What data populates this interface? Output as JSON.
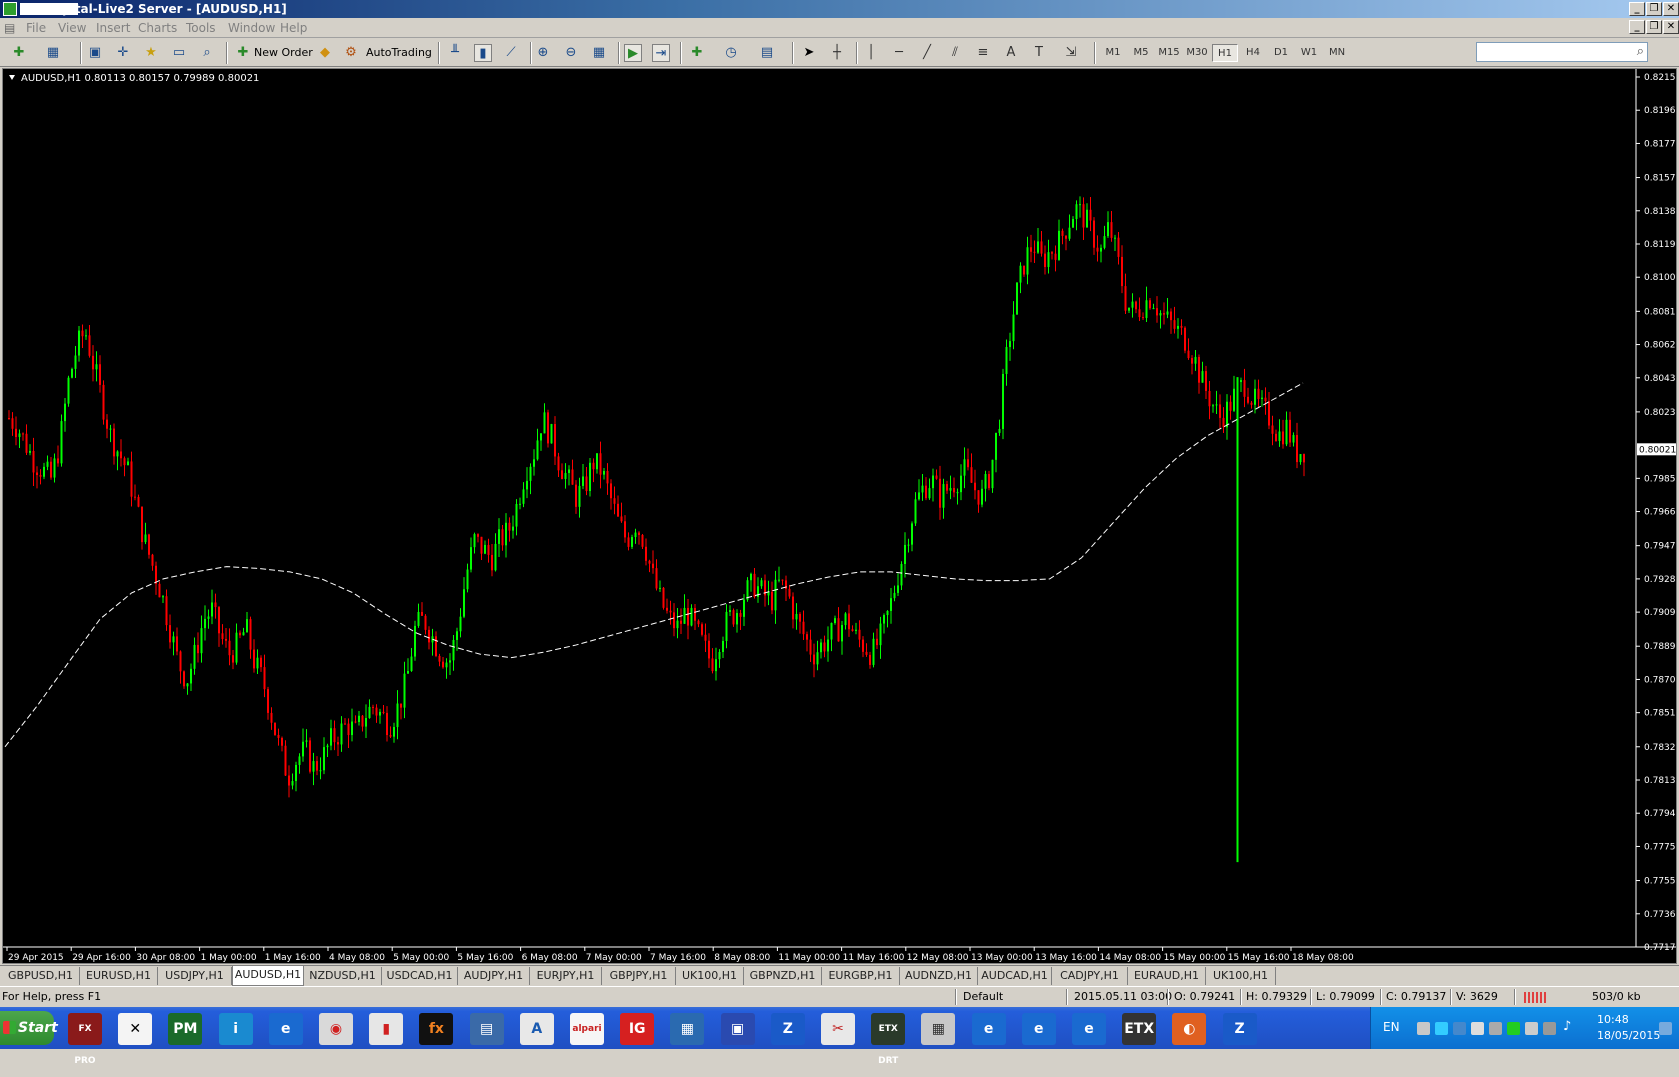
{
  "window": {
    "title": "ETXCapital-Live2 Server - [AUDUSD,H1]",
    "controls": [
      "_",
      "❐",
      "✕"
    ],
    "mdi_controls": [
      "_",
      "❐",
      "✕"
    ]
  },
  "menu": [
    "File",
    "View",
    "Insert",
    "Charts",
    "Tools",
    "Window",
    "Help"
  ],
  "toolbar": {
    "new_order": "New Order",
    "autotrading": "AutoTrading",
    "timeframes": [
      "M1",
      "M5",
      "M15",
      "M30",
      "H1",
      "H4",
      "D1",
      "W1",
      "MN"
    ],
    "selected_timeframe": "H1",
    "search_placeholder": ""
  },
  "chart_header": "AUDUSD,H1  0.80113 0.80157 0.79989 0.80021",
  "chart_data": {
    "type": "candlestick",
    "symbol": "AUDUSD",
    "timeframe": "H1",
    "ohlc_last": {
      "open": 0.80113,
      "high": 0.80157,
      "low": 0.79989,
      "close": 0.80021
    },
    "current_price": "0.80021",
    "ylim": [
      0.77175,
      0.8215
    ],
    "y_ticks": [
      "0.82150",
      "0.81960",
      "0.81770",
      "0.81575",
      "0.81385",
      "0.81195",
      "0.81005",
      "0.80810",
      "0.80620",
      "0.80430",
      "0.80235",
      "0.79855",
      "0.79665",
      "0.79470",
      "0.79280",
      "0.79090",
      "0.78895",
      "0.78705",
      "0.78515",
      "0.78320",
      "0.78130",
      "0.77940",
      "0.77750",
      "0.77555",
      "0.77365",
      "0.77175"
    ],
    "x_ticks": [
      "29 Apr 2015",
      "29 Apr 16:00",
      "30 Apr 08:00",
      "1 May 00:00",
      "1 May 16:00",
      "4 May 08:00",
      "5 May 00:00",
      "5 May 16:00",
      "6 May 08:00",
      "7 May 00:00",
      "7 May 16:00",
      "8 May 08:00",
      "11 May 00:00",
      "11 May 16:00",
      "12 May 08:00",
      "13 May 00:00",
      "13 May 16:00",
      "14 May 08:00",
      "15 May 00:00",
      "15 May 16:00",
      "18 May 08:00"
    ],
    "close_path": [
      0.802,
      0.8015,
      0.8005,
      0.7995,
      0.799,
      0.7985,
      0.8005,
      0.804,
      0.806,
      0.807,
      0.805,
      0.803,
      0.801,
      0.8,
      0.799,
      0.797,
      0.795,
      0.7935,
      0.792,
      0.79,
      0.788,
      0.787,
      0.7885,
      0.7905,
      0.791,
      0.7895,
      0.7885,
      0.789,
      0.79,
      0.788,
      0.787,
      0.785,
      0.783,
      0.7815,
      0.7825,
      0.783,
      0.782,
      0.7825,
      0.7835,
      0.784,
      0.7845,
      0.784,
      0.785,
      0.7855,
      0.785,
      0.7845,
      0.7855,
      0.787,
      0.79,
      0.7905,
      0.7895,
      0.7885,
      0.788,
      0.79,
      0.793,
      0.795,
      0.7945,
      0.794,
      0.795,
      0.7955,
      0.797,
      0.799,
      0.8,
      0.802,
      0.801,
      0.7995,
      0.7985,
      0.7975,
      0.798,
      0.7995,
      0.799,
      0.7975,
      0.796,
      0.795,
      0.796,
      0.795,
      0.793,
      0.7915,
      0.7905,
      0.79,
      0.791,
      0.79,
      0.789,
      0.788,
      0.7895,
      0.7905,
      0.791,
      0.792,
      0.7925,
      0.792,
      0.7915,
      0.7925,
      0.792,
      0.7905,
      0.7895,
      0.7885,
      0.789,
      0.7895,
      0.79,
      0.7905,
      0.7895,
      0.789,
      0.7885,
      0.7895,
      0.791,
      0.793,
      0.795,
      0.797,
      0.798,
      0.7985,
      0.7975,
      0.798,
      0.7985,
      0.799,
      0.798,
      0.7975,
      0.799,
      0.802,
      0.806,
      0.809,
      0.811,
      0.812,
      0.811,
      0.8115,
      0.812,
      0.813,
      0.814,
      0.8135,
      0.8125,
      0.8115,
      0.813,
      0.811,
      0.8085,
      0.808,
      0.8085,
      0.809,
      0.808,
      0.8075,
      0.807,
      0.8065,
      0.8055,
      0.804,
      0.803,
      0.802,
      0.8025,
      0.8035,
      0.804,
      0.803,
      0.8025,
      0.802,
      0.801,
      0.8015,
      0.8,
      0.8002
    ],
    "spike": {
      "index": 145,
      "low": 0.7766
    },
    "ma_path": [
      0.7832,
      0.7855,
      0.788,
      0.7905,
      0.792,
      0.7928,
      0.7932,
      0.7935,
      0.7934,
      0.7932,
      0.7928,
      0.792,
      0.7908,
      0.7897,
      0.789,
      0.7885,
      0.7883,
      0.7886,
      0.789,
      0.7895,
      0.79,
      0.7905,
      0.791,
      0.7915,
      0.792,
      0.7925,
      0.7929,
      0.7932,
      0.7932,
      0.793,
      0.7928,
      0.7927,
      0.7927,
      0.7928,
      0.794,
      0.796,
      0.798,
      0.7997,
      0.801,
      0.802,
      0.803,
      0.804
    ]
  },
  "symbol_tabs": [
    "GBPUSD,H1",
    "EURUSD,H1",
    "USDJPY,H1",
    "AUDUSD,H1",
    "NZDUSD,H1",
    "USDCAD,H1",
    "AUDJPY,H1",
    "EURJPY,H1",
    "GBPJPY,H1",
    "UK100,H1",
    "GBPNZD,H1",
    "EURGBP,H1",
    "AUDNZD,H1",
    "AUDCAD,H1",
    "CADJPY,H1",
    "EURAUD,H1",
    "UK100,H1"
  ],
  "selected_tab": "AUDUSD,H1",
  "status": {
    "help": "For Help, press F1",
    "profile": "Default",
    "datetime": "2015.05.11 03:00",
    "open": "O: 0.79241",
    "high": "H: 0.79329",
    "low": "L: 0.79099",
    "close": "C: 0.79137",
    "volume": "V: 3629",
    "traffic": "503/0 kb"
  },
  "taskbar": {
    "start": "Start",
    "apps": [
      "FX PRO",
      "✕",
      "PM",
      "i",
      "e",
      "◉",
      "▮",
      "fx",
      "▤",
      "A",
      "alpari",
      "IG",
      "▦",
      "▣",
      "Z",
      "✂",
      "ETX DRT",
      "▦",
      "e",
      "e",
      "e",
      "ETX",
      "◐",
      "Z"
    ],
    "lang": "EN",
    "time": "10:48",
    "date": "18/05/2015"
  },
  "colors": {
    "bull": "#00ff00",
    "bear": "#ff0000",
    "background": "#000000",
    "axis_text": "#ffffff",
    "ma_line": "#ffffff"
  }
}
